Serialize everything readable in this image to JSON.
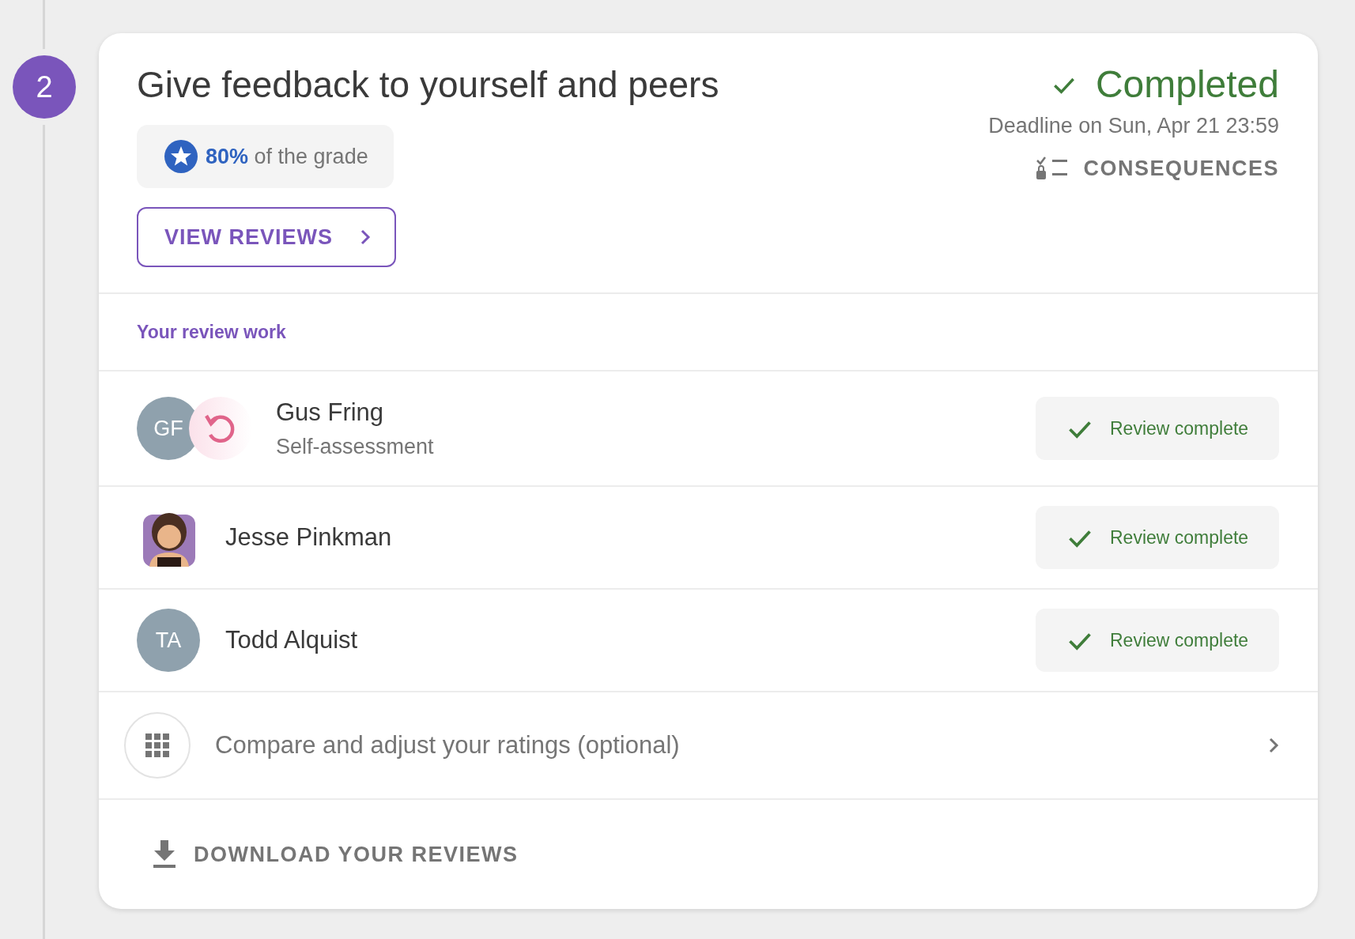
{
  "step": {
    "number": "2"
  },
  "card": {
    "title": "Give feedback to yourself and peers",
    "status": {
      "label": "Completed",
      "completed": true
    },
    "deadline": "Deadline on Sun, Apr 21 23:59",
    "consequences": "CONSEQUENCES",
    "grade": "**80%** of the grade",
    "view_reviews": "VIEW REVIEWS",
    "section_title": "Your review work",
    "reviews": [
      {
        "avatar": {
          "kind": "initials",
          "text": "GF"
        },
        "undo_badge": true,
        "name": "Gus Fring",
        "subtitle": "Self-assessment",
        "status": "Review complete",
        "complete": true
      },
      {
        "avatar": {
          "kind": "illustration"
        },
        "undo_badge": false,
        "name": "Jesse Pinkman",
        "status": "Review complete",
        "complete": true
      },
      {
        "avatar": {
          "kind": "initials",
          "text": "TA"
        },
        "undo_badge": false,
        "name": "Todd Alquist",
        "status": "Review complete",
        "complete": true
      }
    ],
    "compare": "Compare and adjust your ratings (optional)",
    "download": "DOWNLOAD YOUR REVIEWS"
  }
}
